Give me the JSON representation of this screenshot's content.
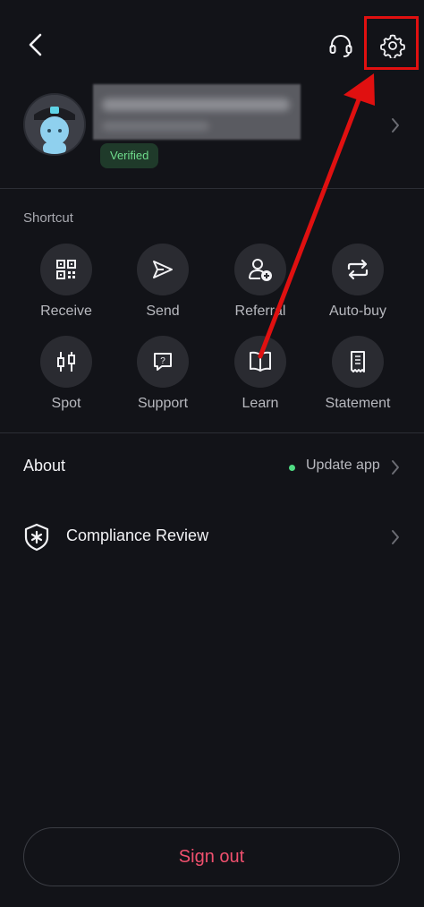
{
  "header": {
    "back_icon": "chevron-left-icon",
    "support_icon": "headset-icon",
    "settings_icon": "gear-icon"
  },
  "profile": {
    "email": "",
    "verified_label": "Verified"
  },
  "shortcuts": {
    "title": "Shortcut",
    "items": [
      {
        "label": "Receive",
        "icon": "qr-code-icon"
      },
      {
        "label": "Send",
        "icon": "send-icon"
      },
      {
        "label": "Referral",
        "icon": "add-user-icon"
      },
      {
        "label": "Auto-buy",
        "icon": "repeat-icon"
      },
      {
        "label": "Spot",
        "icon": "candlestick-icon"
      },
      {
        "label": "Support",
        "icon": "help-chat-icon"
      },
      {
        "label": "Learn",
        "icon": "book-icon"
      },
      {
        "label": "Statement",
        "icon": "receipt-icon"
      }
    ]
  },
  "about": {
    "label": "About",
    "update_label": "Update app"
  },
  "compliance": {
    "label": "Compliance Review",
    "icon": "shield-asterisk-icon"
  },
  "sign_out": {
    "label": "Sign out"
  },
  "colors": {
    "background": "#121318",
    "accent_red": "#f0506e",
    "verified_green": "#6fdc8c",
    "annotation_red": "#e01010"
  }
}
